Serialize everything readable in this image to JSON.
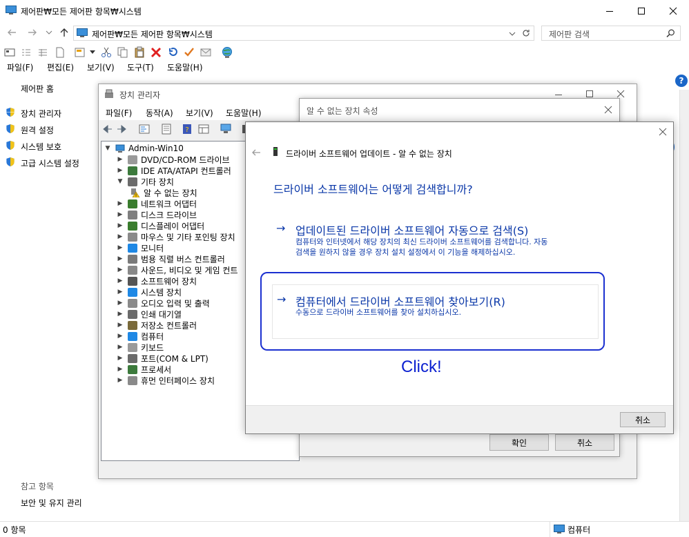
{
  "main_window": {
    "title": "제어판₩모든 제어판 항목₩시스템",
    "address": "제어판₩모든 제어판 항목₩시스템",
    "search_placeholder": "제어판 검색",
    "menu": [
      "파일(F)",
      "편집(E)",
      "보기(V)",
      "도구(T)",
      "도움말(H)"
    ],
    "help_glyph": "?"
  },
  "left_nav": {
    "home": "제어판 홈",
    "links": [
      "장치 관리자",
      "원격 설정",
      "시스템 보호",
      "고급 시스템 설정"
    ],
    "see_also_title": "참고 항목",
    "see_also": [
      "보안 및 유지 관리"
    ]
  },
  "status_bar": {
    "count": "0 항목",
    "computer": "컴퓨터"
  },
  "device_manager": {
    "title": "장치 관리자",
    "menu": [
      "파일(F)",
      "동작(A)",
      "보기(V)",
      "도움말(H)"
    ],
    "root": "Admin-Win10",
    "tree": [
      {
        "label": "DVD/CD-ROM 드라이브",
        "color": "#9a9a9a"
      },
      {
        "label": "IDE ATA/ATAPI 컨트롤러",
        "color": "#3c7a3c"
      },
      {
        "label": "기타 장치",
        "color": "#6b6b6b"
      },
      {
        "label": "알 수 없는 장치",
        "color": "#d9a400"
      },
      {
        "label": "네트워크 어댑터",
        "color": "#3a7d2e"
      },
      {
        "label": "디스크 드라이브",
        "color": "#7f7f7f"
      },
      {
        "label": "디스플레이 어댑터",
        "color": "#3a7d2e"
      },
      {
        "label": "마우스 및 기타 포인팅 장치",
        "color": "#8a8a8a"
      },
      {
        "label": "모니터",
        "color": "#1e88e5"
      },
      {
        "label": "범용 직렬 버스 컨트롤러",
        "color": "#7a7a7a"
      },
      {
        "label": "사운드, 비디오 및 게임 컨트",
        "color": "#888888"
      },
      {
        "label": "소프트웨어 장치",
        "color": "#555555"
      },
      {
        "label": "시스템 장치",
        "color": "#1e88e5"
      },
      {
        "label": "오디오 입력 및 출력",
        "color": "#8a8a8a"
      },
      {
        "label": "인쇄 대기열",
        "color": "#6b6b6b"
      },
      {
        "label": "저장소 컨트롤러",
        "color": "#7a6a3a"
      },
      {
        "label": "컴퓨터",
        "color": "#1e88e5"
      },
      {
        "label": "키보드",
        "color": "#9a9a9a"
      },
      {
        "label": "포트(COM & LPT)",
        "color": "#6b6b6b"
      },
      {
        "label": "프로세서",
        "color": "#3c7a3c"
      },
      {
        "label": "휴먼 인터페이스 장치",
        "color": "#8a8a8a"
      }
    ]
  },
  "properties_dialog": {
    "title": "알 수 없는 장치 속성",
    "ok": "확인",
    "cancel": "취소"
  },
  "wizard": {
    "header": "드라이버 소프트웨어 업데이트 - 알 수 없는 장치",
    "question": "드라이버 소프트웨어는 어떻게 검색합니까?",
    "option1_title": "업데이트된 드라이버 소프트웨어 자동으로 검색(S)",
    "option1_desc_line1": "컴퓨터와 인터넷에서 해당 장치의 최신 드라이버 소프트웨어를 검색합니다. 자동",
    "option1_desc_line2": "검색을 원하지 않을 경우 장치 설치 설정에서 이 기능을 해제하십시오.",
    "option2_title": "컴퓨터에서 드라이버 소프트웨어 찾아보기(R)",
    "option2_desc": "수동으로 드라이버 소프트웨어를 찾아 설치하십시오.",
    "cancel": "취소",
    "arrow_glyph": "→"
  },
  "annotation": {
    "text": "Click!",
    "color": "#1a2fd0"
  }
}
